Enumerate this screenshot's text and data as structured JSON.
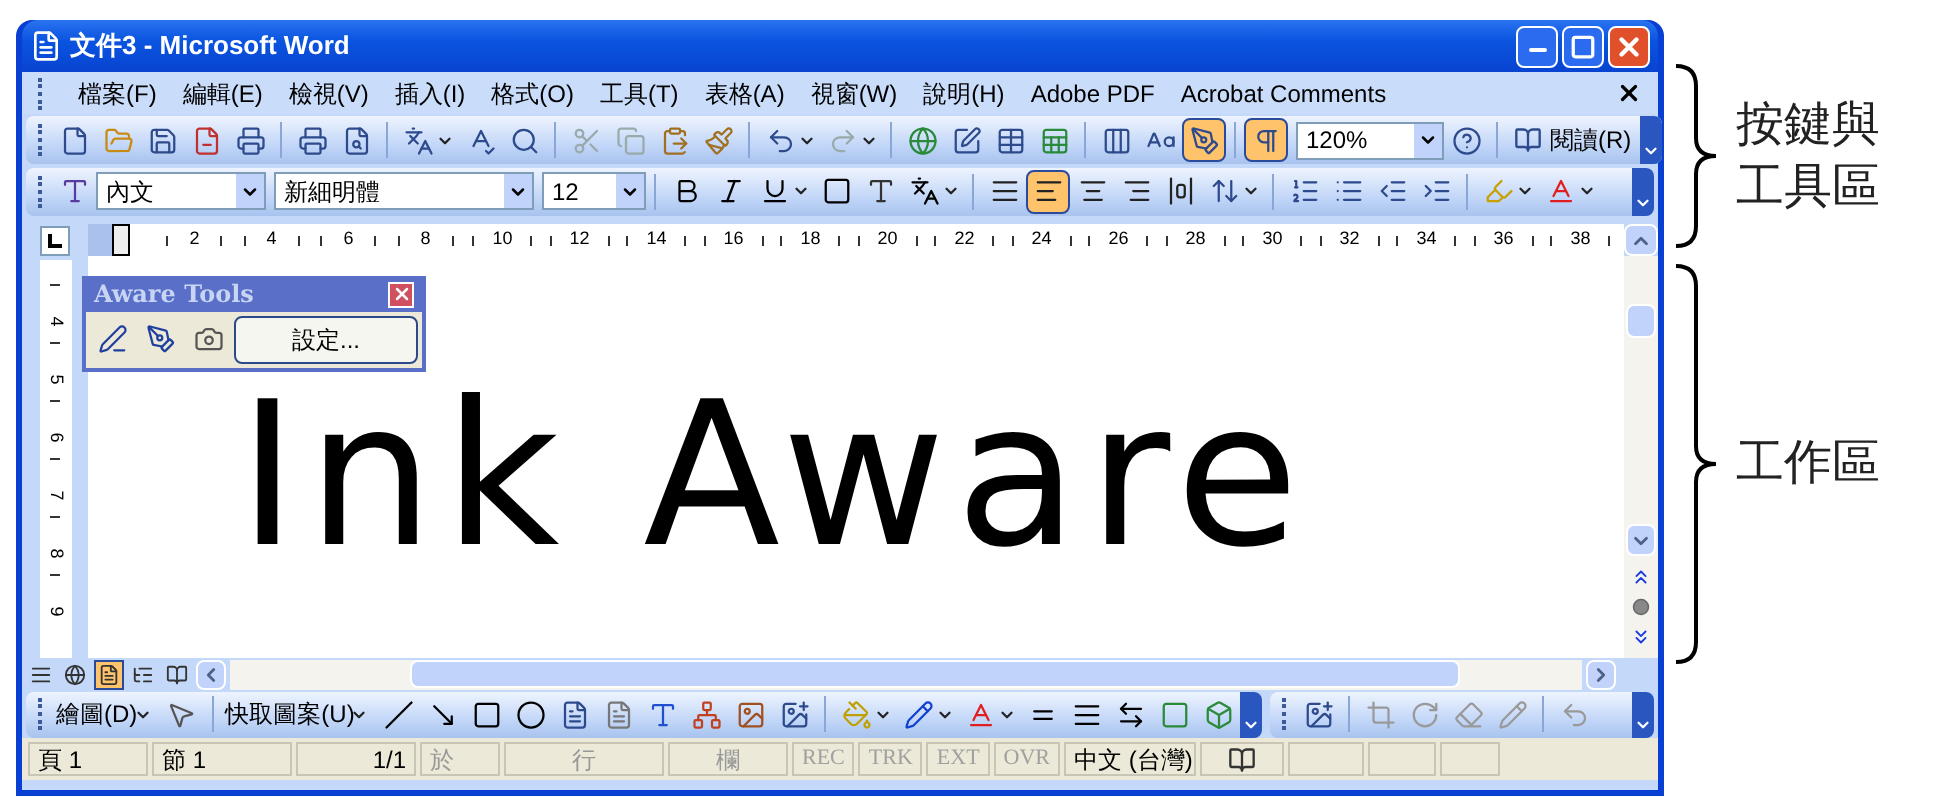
{
  "window": {
    "title": "文件3 - Microsoft Word"
  },
  "menu_bar": {
    "items": [
      "檔案(F)",
      "編輯(E)",
      "檢視(V)",
      "插入(I)",
      "格式(O)",
      "工具(T)",
      "表格(A)",
      "視窗(W)",
      "說明(H)",
      "Adobe PDF",
      "Acrobat Comments"
    ]
  },
  "standard_toolbar": {
    "ink_pressed": true,
    "show_marks_pressed": true,
    "zoom": "120%",
    "read_button": "閱讀(R)"
  },
  "formatting_toolbar": {
    "style": "內文",
    "font": "新細明體",
    "size": "12",
    "alignment_buttons": [
      {
        "selected": false
      },
      {
        "selected": true
      },
      {
        "selected": false
      },
      {
        "selected": false
      },
      {
        "selected": false
      }
    ]
  },
  "horizontal_ruler": {
    "labels": [
      "2",
      "4",
      "6",
      "8",
      "10",
      "12",
      "14",
      "16",
      "18",
      "20",
      "22",
      "24",
      "26",
      "28",
      "30",
      "32",
      "34",
      "36",
      "38"
    ]
  },
  "vertical_ruler": {
    "labels": [
      "4",
      "5",
      "6",
      "7",
      "8",
      "9"
    ]
  },
  "aware_tools": {
    "title": "Aware Tools",
    "settings_button": "設定..."
  },
  "document": {
    "ink_text": "Ink Aware"
  },
  "views": [
    {
      "selected": false
    },
    {
      "selected": false
    },
    {
      "selected": true
    },
    {
      "selected": false
    },
    {
      "selected": false
    }
  ],
  "drawing_toolbar": {
    "draw_menu": "繪圖(D)",
    "autoshapes_menu": "快取圖案(U)"
  },
  "status_bar": {
    "page": "頁 1",
    "section": "節 1",
    "pages": "1/1",
    "at": "於",
    "line": "行",
    "column": "欄",
    "modes": [
      {
        "label": "REC",
        "on": false
      },
      {
        "label": "TRK",
        "on": false
      },
      {
        "label": "EXT",
        "on": false
      },
      {
        "label": "OVR",
        "on": false
      }
    ],
    "language": "中文 (台灣)"
  },
  "annotations": [
    {
      "label": "按鍵與工具區"
    },
    {
      "label": "工作區"
    }
  ]
}
